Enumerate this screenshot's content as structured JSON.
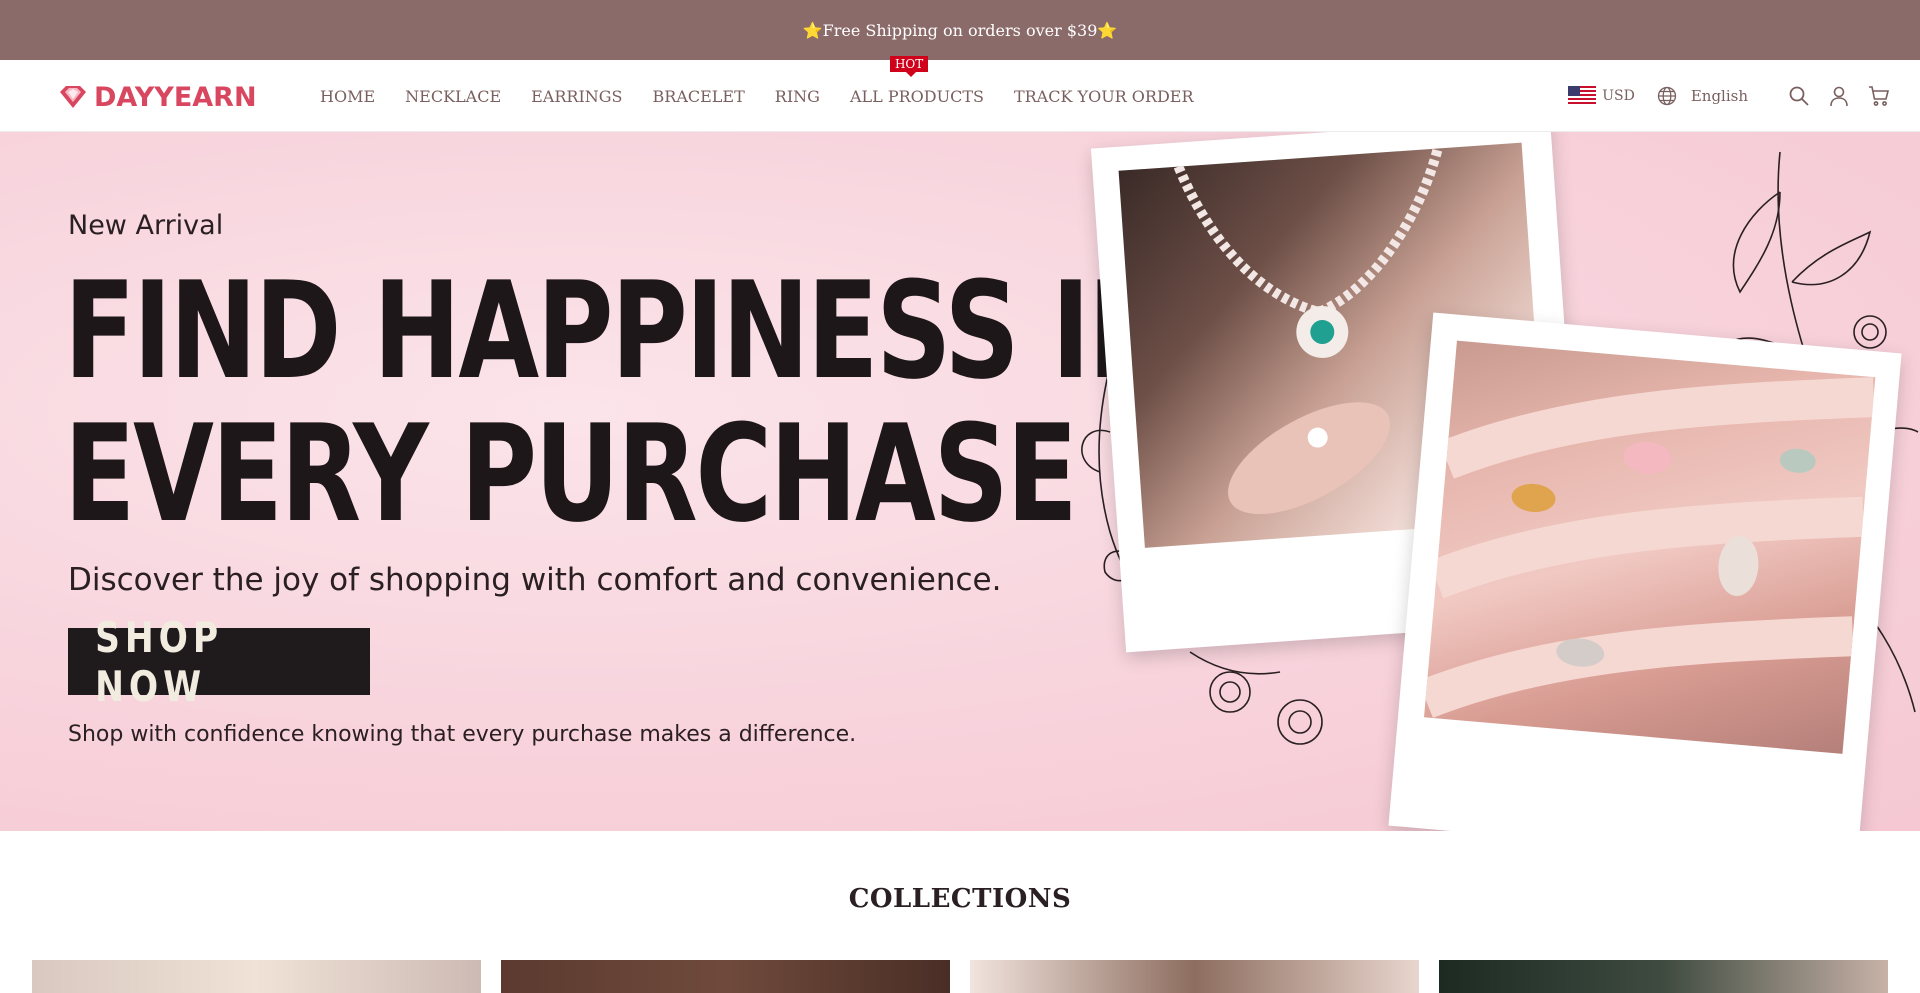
{
  "announcement": {
    "text": "⭐Free Shipping on orders over $39⭐"
  },
  "header": {
    "logo_text": "DAYYEARN",
    "nav": [
      {
        "label": "HOME"
      },
      {
        "label": "NECKLACE"
      },
      {
        "label": "EARRINGS"
      },
      {
        "label": "BRACELET"
      },
      {
        "label": "RING"
      },
      {
        "label": "ALL PRODUCTS",
        "badge": "HOT"
      },
      {
        "label": "TRACK YOUR ORDER"
      }
    ],
    "currency": "USD",
    "language": "English",
    "icons": [
      "us-flag-icon",
      "globe-icon",
      "search-icon",
      "account-icon",
      "cart-icon"
    ]
  },
  "hero": {
    "eyebrow": "New Arrival",
    "title_line1": "FIND HAPPINESS IN",
    "title_line2": "EVERY PURCHASE",
    "description": "Discover the joy of shopping with comfort and convenience.",
    "cta_label": "SHOP NOW",
    "note": "Shop with confidence knowing that every purchase makes a difference."
  },
  "collections": {
    "title": "COLLECTIONS",
    "cards": 4
  },
  "colors": {
    "announcement_bg": "#8b6b6a",
    "brand": "#d8475f",
    "hot_badge": "#d0011b",
    "hero_bg": "#f8d3dc",
    "cta_bg": "#1f1b1d"
  }
}
